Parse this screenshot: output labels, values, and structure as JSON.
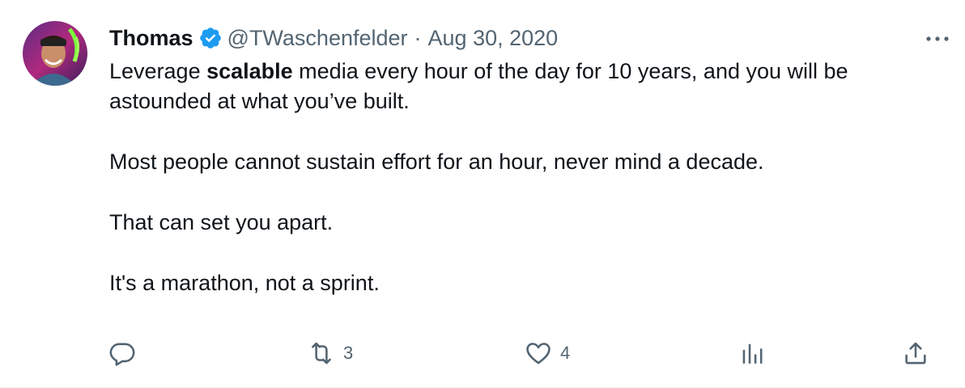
{
  "author": {
    "name": "Thomas",
    "handle": "@TWaschenfelder",
    "separator": "·",
    "date": "Aug 30, 2020",
    "verified": true
  },
  "tweet": {
    "line1_before": "Leverage ",
    "line1_bold": "scalable",
    "line1_after": " media every hour of the day for 10 years, and you will be astounded at what you’ve built.",
    "paragraph2": "Most people cannot sustain effort for an hour, never mind a decade.",
    "paragraph3": "That can set you apart.",
    "paragraph4": "It's a marathon, not a sprint."
  },
  "actions": {
    "reply_count": "",
    "retweet_count": "3",
    "like_count": "4",
    "views_count": ""
  },
  "colors": {
    "text": "#0f1419",
    "secondary": "#536471",
    "verified_blue": "#1d9bf0"
  },
  "icons": [
    "more-icon",
    "reply-icon",
    "retweet-icon",
    "like-icon",
    "views-icon",
    "share-icon",
    "verified-icon"
  ]
}
